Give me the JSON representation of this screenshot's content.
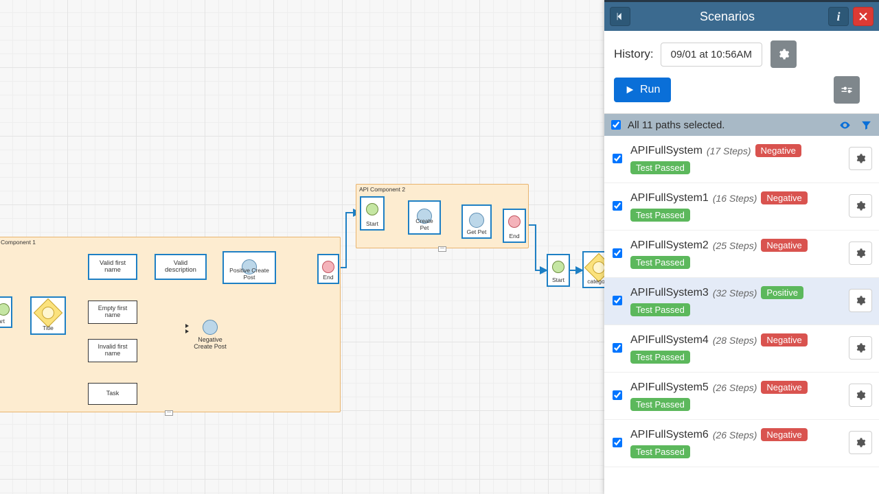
{
  "panel": {
    "title": "Scenarios",
    "history_label": "History:",
    "history_value": "09/01 at 10:56AM",
    "run_label": "Run",
    "select_all_text": "All 11 paths selected.",
    "select_all_checked": true
  },
  "badges": {
    "negative": "Negative",
    "positive": "Positive",
    "passed": "Test Passed"
  },
  "scenarios": [
    {
      "name": "APIFullSystem",
      "steps": "(17 Steps)",
      "type": "neg",
      "status": "passed",
      "checked": true,
      "hl": false
    },
    {
      "name": "APIFullSystem1",
      "steps": "(16 Steps)",
      "type": "neg",
      "status": "passed",
      "checked": true,
      "hl": false
    },
    {
      "name": "APIFullSystem2",
      "steps": "(25 Steps)",
      "type": "neg",
      "status": "passed",
      "checked": true,
      "hl": false
    },
    {
      "name": "APIFullSystem3",
      "steps": "(32 Steps)",
      "type": "pos",
      "status": "passed",
      "checked": true,
      "hl": true
    },
    {
      "name": "APIFullSystem4",
      "steps": "(28 Steps)",
      "type": "neg",
      "status": "passed",
      "checked": true,
      "hl": false
    },
    {
      "name": "APIFullSystem5",
      "steps": "(26 Steps)",
      "type": "neg",
      "status": "passed",
      "checked": true,
      "hl": false
    },
    {
      "name": "APIFullSystem6",
      "steps": "(26 Steps)",
      "type": "neg",
      "status": "passed",
      "checked": true,
      "hl": false
    }
  ],
  "diagram": {
    "group1_label": "Component 1",
    "group2_label": "API Component 2",
    "nodes": {
      "start_left": "art",
      "title": "Title",
      "valid_first_name": "Valid first name",
      "valid_description": "Valid description",
      "positive_create_post": "Positive Create Post",
      "end1": "End",
      "empty_first_name": "Empty first name",
      "invalid_first_name": "Invalid first name",
      "task": "Task",
      "negative_create_post": "Negative Create Post",
      "g2_start": "Start",
      "g2_create_pet": "Create Pet",
      "g2_get_pet": "Get Pet",
      "g2_end": "End",
      "right_start": "Start",
      "right_category": "catego"
    }
  }
}
